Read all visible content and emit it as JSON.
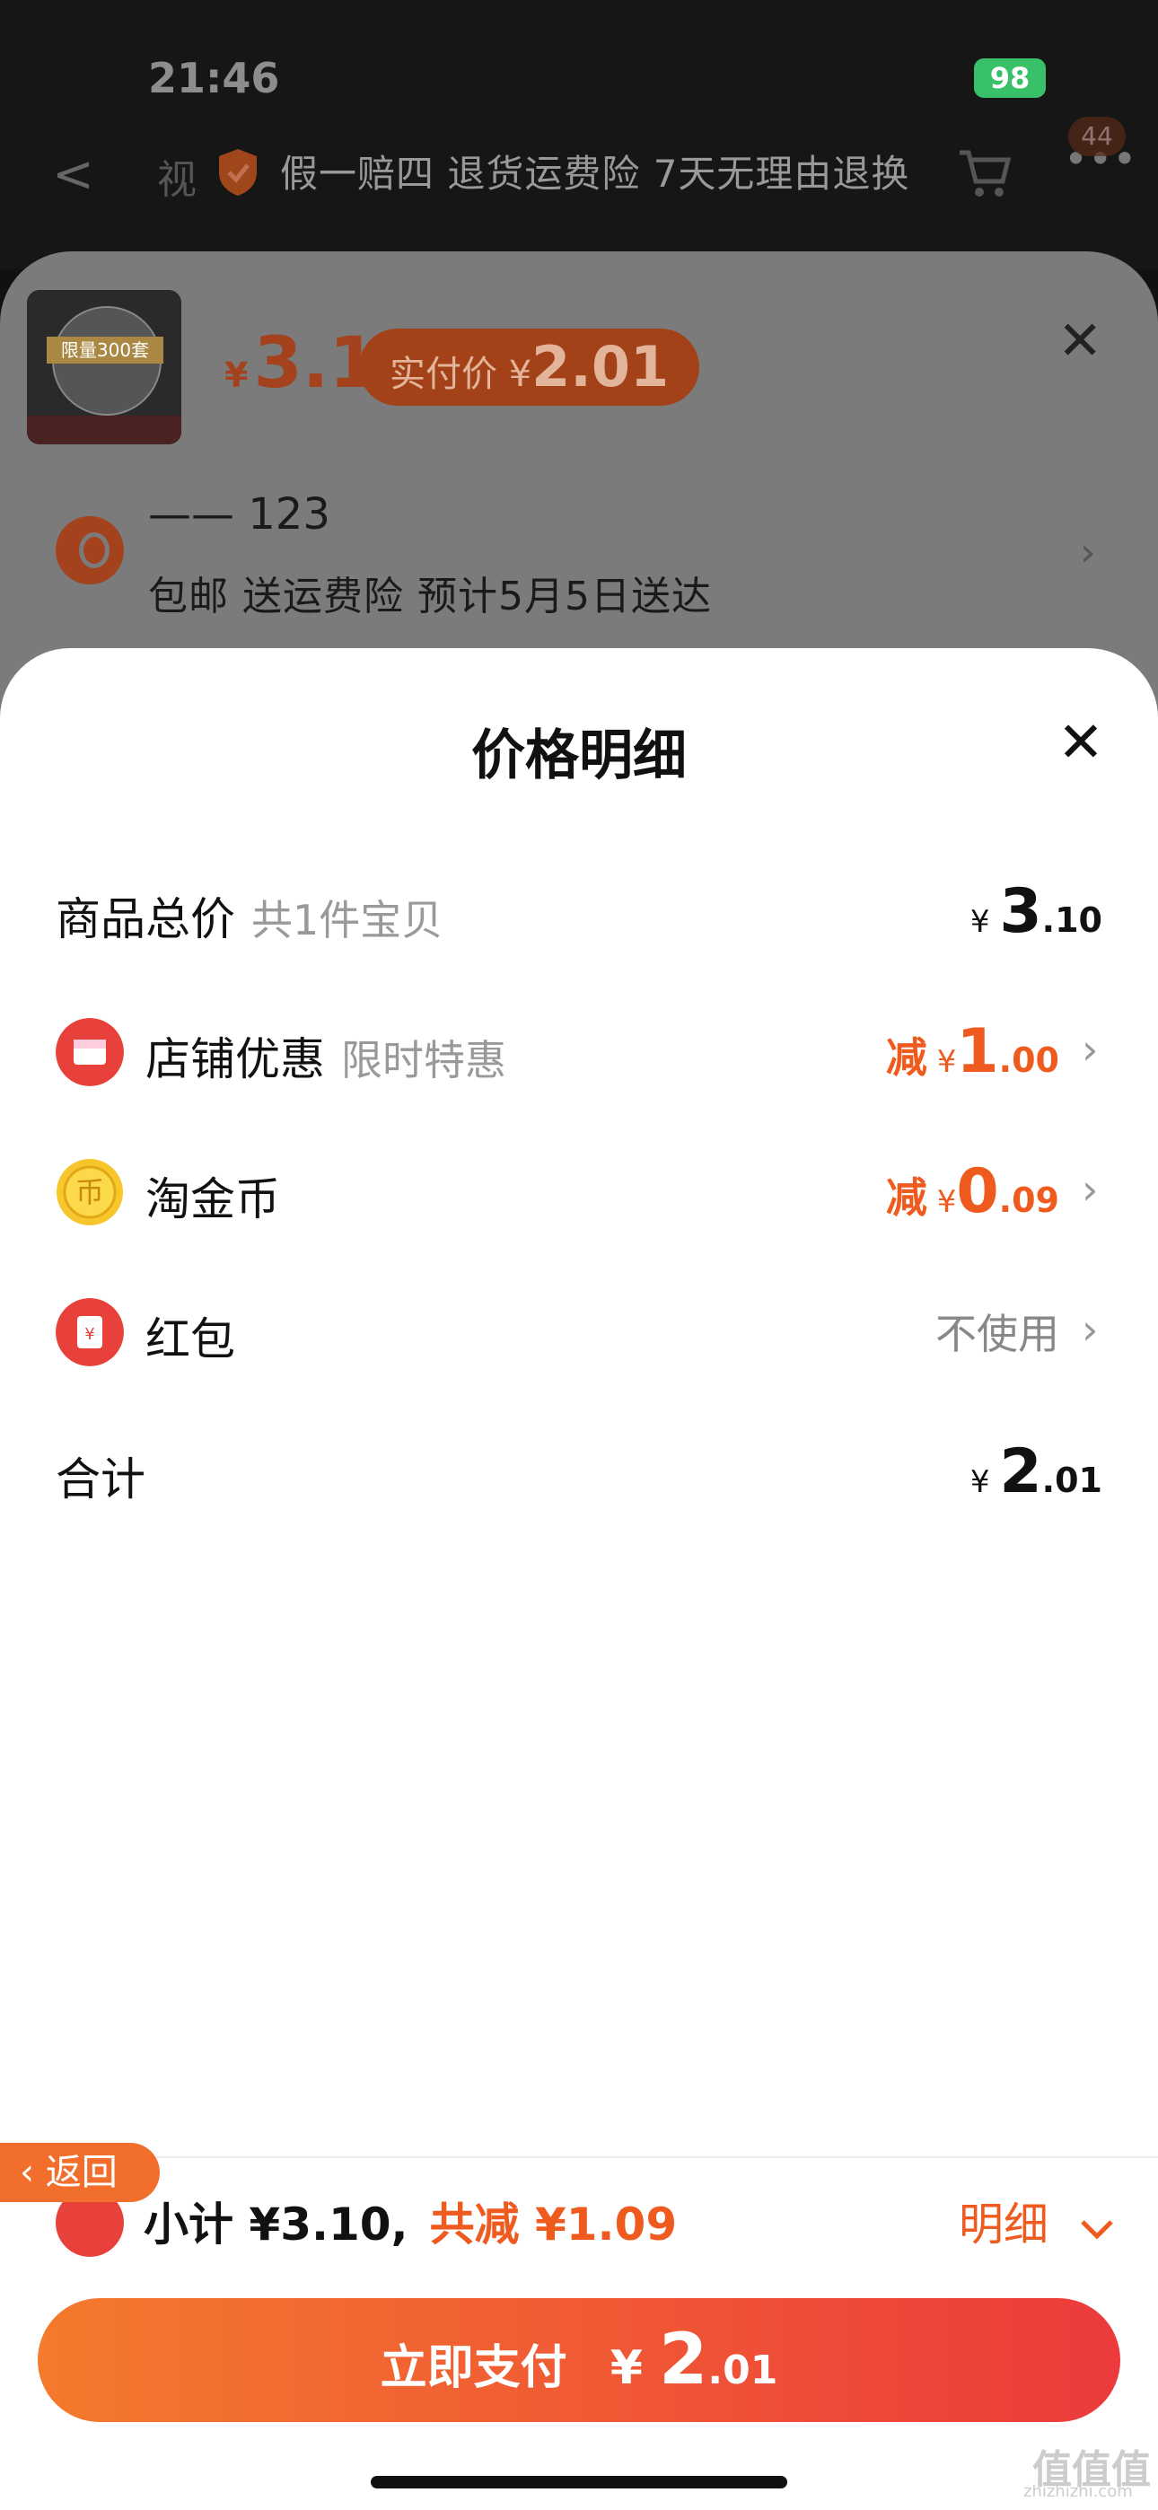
{
  "status": {
    "time": "21:46",
    "battery": "98"
  },
  "nav": {
    "back": "<",
    "video_text": "视",
    "promise": "假一赔四 退货运费险 7天无理由退换",
    "cart_badge": "44",
    "more": "•••"
  },
  "product": {
    "thumb_tag": "限量300套",
    "price_yen": "¥",
    "price": "3.1",
    "pay_label": "实付价 ¥",
    "pay_value": "2.01"
  },
  "address": {
    "name": "—— 123",
    "info": "包邮  送运费险  预计5月5日送达"
  },
  "panel": {
    "title": "价格明细",
    "rows": [
      {
        "label": "商品总价",
        "sub": "共1件宝贝",
        "prefix": "",
        "yen": "¥",
        "int": "3",
        "dec": ".10"
      },
      {
        "label": "店铺优惠",
        "sub": "限时特惠",
        "prefix": "减",
        "yen": "¥",
        "int": "1",
        "dec": ".00"
      },
      {
        "label": "淘金币",
        "sub": "",
        "prefix": "减",
        "yen": "¥",
        "int": "0",
        "dec": ".09"
      },
      {
        "label": "红包",
        "sub": "",
        "value": "不使用"
      },
      {
        "label": "合计",
        "sub": "",
        "prefix": "",
        "yen": "¥",
        "int": "2",
        "dec": ".01"
      }
    ]
  },
  "footer": {
    "back_label": "返回",
    "subtotal": "小计 ¥3.10,",
    "discount": "共减 ¥1.09",
    "detail": "明细",
    "pay_label": "立即支付",
    "pay_yen": "¥",
    "pay_int": "2",
    "pay_dec": ".01"
  },
  "watermark": {
    "main": "值值值",
    "url": "zhizhizhi.com"
  }
}
